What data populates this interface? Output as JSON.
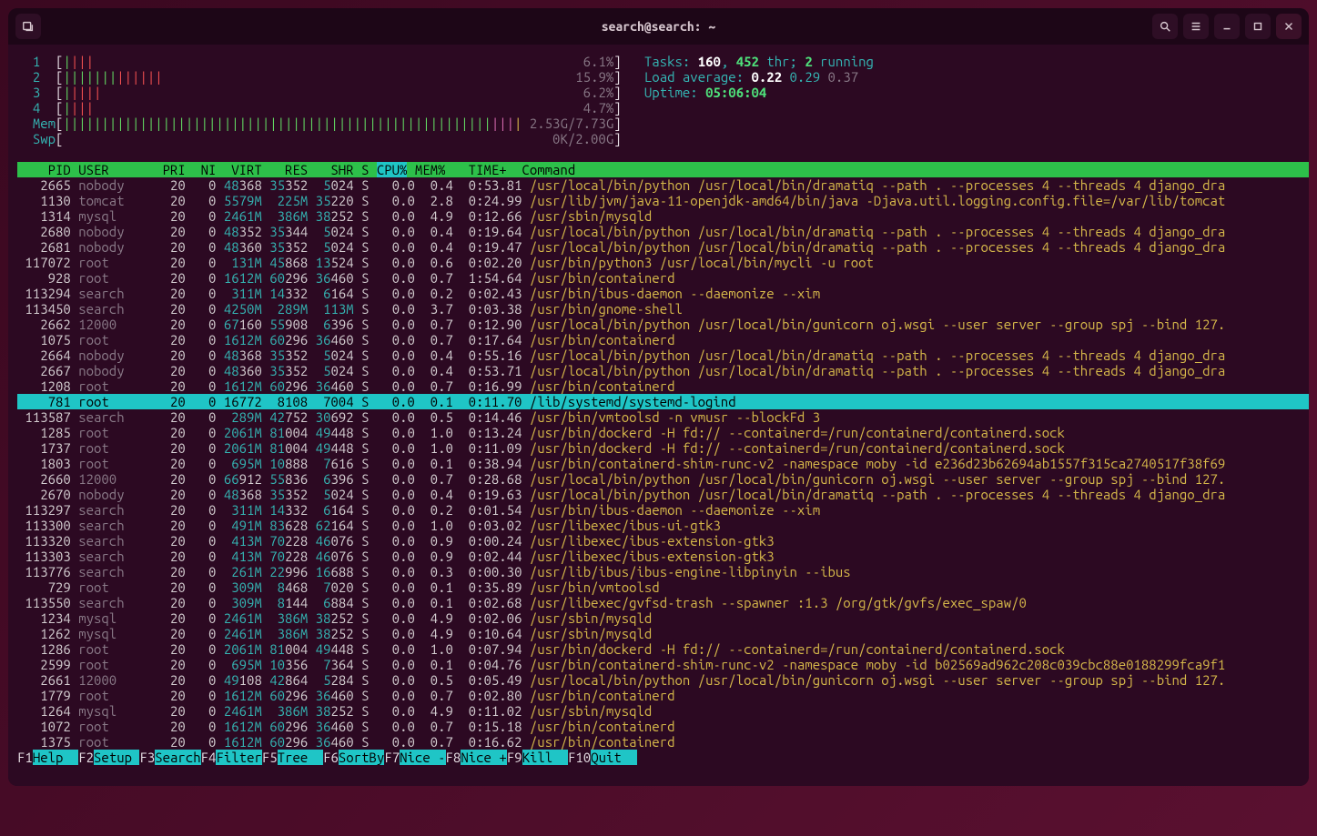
{
  "window": {
    "title": "search@search: ~"
  },
  "cpu_meters": [
    {
      "id": "1",
      "bars_g": 1,
      "bars_r": 3,
      "pct": "6.1%"
    },
    {
      "id": "2",
      "bars_g": 7,
      "bars_r": 6,
      "pct": "15.9%"
    },
    {
      "id": "3",
      "bars_g": 1,
      "bars_r": 4,
      "pct": "6.2%"
    },
    {
      "id": "4",
      "bars_g": 1,
      "bars_r": 3,
      "pct": "4.7%"
    }
  ],
  "mem": {
    "label": "Mem",
    "bars_g": 56,
    "bars_b": 3,
    "bars_y": 1,
    "text": "2.53G/7.73G"
  },
  "swp": {
    "label": "Swp",
    "text": "0K/2.00G"
  },
  "stats": {
    "tasks_label": "Tasks: ",
    "tasks": "160",
    "thr": "452",
    "thr_label": " thr; ",
    "running": "2",
    "running_label": " running",
    "loadavg_label": "Load average: ",
    "l1": "0.22",
    "l2": "0.29",
    "l3": "0.37",
    "uptime_label": "Uptime: ",
    "uptime": "05:06:04"
  },
  "columns": {
    "line": "    PID USER       PRI  NI  VIRT   RES   SHR S ",
    "sort": "CPU%",
    "rest": " MEM%   TIME+  Command"
  },
  "selected": {
    "pid": "781",
    "user": "root",
    "pri": "20",
    "ni": "0",
    "virt": "16772",
    "res": "8108",
    "shr": "7004",
    "s": "S",
    "cpu": "0.0",
    "mem": "0.1",
    "time": "0:11.70",
    "cmd": "/lib/systemd/systemd-logind"
  },
  "procs_pre": [
    {
      "pid": "2665",
      "user": "nobody",
      "pri": "20",
      "ni": "0",
      "virt": "48368",
      "vhi": "48",
      "res": "35352",
      "rhi": "35",
      "shr": "5024",
      "shi": "5",
      "s": "S",
      "cpu": "0.0",
      "mem": "0.4",
      "time": "0:53.81",
      "cmd": "/usr/local/bin/python /usr/local/bin/dramatiq --path . --processes 4 --threads 4 django_dra"
    },
    {
      "pid": "1130",
      "user": "tomcat",
      "pri": "20",
      "ni": "0",
      "virt": "5579M",
      "vhi": "5579M",
      "res": "225M",
      "rhi": "225M",
      "shr": "35220",
      "shi": "35",
      "s": "S",
      "cpu": "0.0",
      "mem": "2.8",
      "time": "0:24.99",
      "cmd": "/usr/lib/jvm/java-11-openjdk-amd64/bin/java -Djava.util.logging.config.file=/var/lib/tomcat"
    },
    {
      "pid": "1314",
      "user": "mysql",
      "pri": "20",
      "ni": "0",
      "virt": "2461M",
      "vhi": "2461M",
      "res": "386M",
      "rhi": "386M",
      "shr": "38252",
      "shi": "38",
      "s": "S",
      "cpu": "0.0",
      "mem": "4.9",
      "time": "0:12.66",
      "cmd": "/usr/sbin/mysqld"
    },
    {
      "pid": "2680",
      "user": "nobody",
      "pri": "20",
      "ni": "0",
      "virt": "48352",
      "vhi": "48",
      "res": "35344",
      "rhi": "35",
      "shr": "5024",
      "shi": "5",
      "s": "S",
      "cpu": "0.0",
      "mem": "0.4",
      "time": "0:19.64",
      "cmd": "/usr/local/bin/python /usr/local/bin/dramatiq --path . --processes 4 --threads 4 django_dra"
    },
    {
      "pid": "2681",
      "user": "nobody",
      "pri": "20",
      "ni": "0",
      "virt": "48360",
      "vhi": "48",
      "res": "35352",
      "rhi": "35",
      "shr": "5024",
      "shi": "5",
      "s": "S",
      "cpu": "0.0",
      "mem": "0.4",
      "time": "0:19.47",
      "cmd": "/usr/local/bin/python /usr/local/bin/dramatiq --path . --processes 4 --threads 4 django_dra"
    },
    {
      "pid": "117072",
      "user": "root",
      "pri": "20",
      "ni": "0",
      "virt": "131M",
      "vhi": "131M",
      "res": "45868",
      "rhi": "45",
      "shr": "13524",
      "shi": "13",
      "s": "S",
      "cpu": "0.0",
      "mem": "0.6",
      "time": "0:02.20",
      "cmd": "/usr/bin/python3 /usr/local/bin/mycli -u root"
    },
    {
      "pid": "928",
      "user": "root",
      "pri": "20",
      "ni": "0",
      "virt": "1612M",
      "vhi": "1612M",
      "res": "60296",
      "rhi": "60",
      "shr": "36460",
      "shi": "36",
      "s": "S",
      "cpu": "0.0",
      "mem": "0.7",
      "time": "1:54.64",
      "cmd": "/usr/bin/containerd"
    },
    {
      "pid": "113294",
      "user": "search",
      "pri": "20",
      "ni": "0",
      "virt": "311M",
      "vhi": "311M",
      "res": "14332",
      "rhi": "14",
      "shr": "6164",
      "shi": "6",
      "s": "S",
      "cpu": "0.0",
      "mem": "0.2",
      "time": "0:02.43",
      "cmd": "/usr/bin/ibus-daemon --daemonize --xim"
    },
    {
      "pid": "113450",
      "user": "search",
      "pri": "20",
      "ni": "0",
      "virt": "4250M",
      "vhi": "4250M",
      "res": "289M",
      "rhi": "289M",
      "shr": "113M",
      "shi": "113M",
      "s": "S",
      "cpu": "0.0",
      "mem": "3.7",
      "time": "0:03.38",
      "cmd": "/usr/bin/gnome-shell"
    },
    {
      "pid": "2662",
      "user": "12000",
      "pri": "20",
      "ni": "0",
      "virt": "67160",
      "vhi": "67",
      "res": "55908",
      "rhi": "55",
      "shr": "6396",
      "shi": "6",
      "s": "S",
      "cpu": "0.0",
      "mem": "0.7",
      "time": "0:12.90",
      "cmd": "/usr/local/bin/python /usr/local/bin/gunicorn oj.wsgi --user server --group spj --bind 127."
    },
    {
      "pid": "1075",
      "user": "root",
      "pri": "20",
      "ni": "0",
      "virt": "1612M",
      "vhi": "1612M",
      "res": "60296",
      "rhi": "60",
      "shr": "36460",
      "shi": "36",
      "s": "S",
      "cpu": "0.0",
      "mem": "0.7",
      "time": "0:17.64",
      "cmd": "/usr/bin/containerd"
    },
    {
      "pid": "2664",
      "user": "nobody",
      "pri": "20",
      "ni": "0",
      "virt": "48368",
      "vhi": "48",
      "res": "35352",
      "rhi": "35",
      "shr": "5024",
      "shi": "5",
      "s": "S",
      "cpu": "0.0",
      "mem": "0.4",
      "time": "0:55.16",
      "cmd": "/usr/local/bin/python /usr/local/bin/dramatiq --path . --processes 4 --threads 4 django_dra"
    },
    {
      "pid": "2667",
      "user": "nobody",
      "pri": "20",
      "ni": "0",
      "virt": "48360",
      "vhi": "48",
      "res": "35352",
      "rhi": "35",
      "shr": "5024",
      "shi": "5",
      "s": "S",
      "cpu": "0.0",
      "mem": "0.4",
      "time": "0:53.71",
      "cmd": "/usr/local/bin/python /usr/local/bin/dramatiq --path . --processes 4 --threads 4 django_dra"
    },
    {
      "pid": "1208",
      "user": "root",
      "pri": "20",
      "ni": "0",
      "virt": "1612M",
      "vhi": "1612M",
      "res": "60296",
      "rhi": "60",
      "shr": "36460",
      "shi": "36",
      "s": "S",
      "cpu": "0.0",
      "mem": "0.7",
      "time": "0:16.99",
      "cmd": "/usr/bin/containerd"
    }
  ],
  "procs_post": [
    {
      "pid": "113587",
      "user": "search",
      "pri": "20",
      "ni": "0",
      "virt": "289M",
      "vhi": "289M",
      "res": "42752",
      "rhi": "42",
      "shr": "30692",
      "shi": "30",
      "s": "S",
      "cpu": "0.0",
      "mem": "0.5",
      "time": "0:14.46",
      "cmd": "/usr/bin/vmtoolsd -n vmusr --blockFd 3"
    },
    {
      "pid": "1285",
      "user": "root",
      "pri": "20",
      "ni": "0",
      "virt": "2061M",
      "vhi": "2061M",
      "res": "81004",
      "rhi": "81",
      "shr": "49448",
      "shi": "49",
      "s": "S",
      "cpu": "0.0",
      "mem": "1.0",
      "time": "0:13.24",
      "cmd": "/usr/bin/dockerd -H fd:// --containerd=/run/containerd/containerd.sock"
    },
    {
      "pid": "1737",
      "user": "root",
      "pri": "20",
      "ni": "0",
      "virt": "2061M",
      "vhi": "2061M",
      "res": "81004",
      "rhi": "81",
      "shr": "49448",
      "shi": "49",
      "s": "S",
      "cpu": "0.0",
      "mem": "1.0",
      "time": "0:11.09",
      "cmd": "/usr/bin/dockerd -H fd:// --containerd=/run/containerd/containerd.sock"
    },
    {
      "pid": "1803",
      "user": "root",
      "pri": "20",
      "ni": "0",
      "virt": "695M",
      "vhi": "695M",
      "res": "10888",
      "rhi": "10",
      "shr": "7616",
      "shi": "7",
      "s": "S",
      "cpu": "0.0",
      "mem": "0.1",
      "time": "0:38.94",
      "cmd": "/usr/bin/containerd-shim-runc-v2 -namespace moby -id e236d23b62694ab1557f315ca2740517f38f69"
    },
    {
      "pid": "2660",
      "user": "12000",
      "pri": "20",
      "ni": "0",
      "virt": "66912",
      "vhi": "66",
      "res": "55836",
      "rhi": "55",
      "shr": "6396",
      "shi": "6",
      "s": "S",
      "cpu": "0.0",
      "mem": "0.7",
      "time": "0:28.68",
      "cmd": "/usr/local/bin/python /usr/local/bin/gunicorn oj.wsgi --user server --group spj --bind 127."
    },
    {
      "pid": "2670",
      "user": "nobody",
      "pri": "20",
      "ni": "0",
      "virt": "48368",
      "vhi": "48",
      "res": "35352",
      "rhi": "35",
      "shr": "5024",
      "shi": "5",
      "s": "S",
      "cpu": "0.0",
      "mem": "0.4",
      "time": "0:19.63",
      "cmd": "/usr/local/bin/python /usr/local/bin/dramatiq --path . --processes 4 --threads 4 django_dra"
    },
    {
      "pid": "113297",
      "user": "search",
      "pri": "20",
      "ni": "0",
      "virt": "311M",
      "vhi": "311M",
      "res": "14332",
      "rhi": "14",
      "shr": "6164",
      "shi": "6",
      "s": "S",
      "cpu": "0.0",
      "mem": "0.2",
      "time": "0:01.54",
      "cmd": "/usr/bin/ibus-daemon --daemonize --xim"
    },
    {
      "pid": "113300",
      "user": "search",
      "pri": "20",
      "ni": "0",
      "virt": "491M",
      "vhi": "491M",
      "res": "83628",
      "rhi": "83",
      "shr": "62164",
      "shi": "62",
      "s": "S",
      "cpu": "0.0",
      "mem": "1.0",
      "time": "0:03.02",
      "cmd": "/usr/libexec/ibus-ui-gtk3"
    },
    {
      "pid": "113320",
      "user": "search",
      "pri": "20",
      "ni": "0",
      "virt": "413M",
      "vhi": "413M",
      "res": "70228",
      "rhi": "70",
      "shr": "46076",
      "shi": "46",
      "s": "S",
      "cpu": "0.0",
      "mem": "0.9",
      "time": "0:00.24",
      "cmd": "/usr/libexec/ibus-extension-gtk3"
    },
    {
      "pid": "113303",
      "user": "search",
      "pri": "20",
      "ni": "0",
      "virt": "413M",
      "vhi": "413M",
      "res": "70228",
      "rhi": "70",
      "shr": "46076",
      "shi": "46",
      "s": "S",
      "cpu": "0.0",
      "mem": "0.9",
      "time": "0:02.44",
      "cmd": "/usr/libexec/ibus-extension-gtk3"
    },
    {
      "pid": "113776",
      "user": "search",
      "pri": "20",
      "ni": "0",
      "virt": "261M",
      "vhi": "261M",
      "res": "22996",
      "rhi": "22",
      "shr": "16688",
      "shi": "16",
      "s": "S",
      "cpu": "0.0",
      "mem": "0.3",
      "time": "0:00.30",
      "cmd": "/usr/lib/ibus/ibus-engine-libpinyin --ibus"
    },
    {
      "pid": "729",
      "user": "root",
      "pri": "20",
      "ni": "0",
      "virt": "309M",
      "vhi": "309M",
      "res": "8468",
      "rhi": "8",
      "shr": "7020",
      "shi": "7",
      "s": "S",
      "cpu": "0.0",
      "mem": "0.1",
      "time": "0:35.89",
      "cmd": "/usr/bin/vmtoolsd"
    },
    {
      "pid": "113550",
      "user": "search",
      "pri": "20",
      "ni": "0",
      "virt": "309M",
      "vhi": "309M",
      "res": "8144",
      "rhi": "8",
      "shr": "6884",
      "shi": "6",
      "s": "S",
      "cpu": "0.0",
      "mem": "0.1",
      "time": "0:02.68",
      "cmd": "/usr/libexec/gvfsd-trash --spawner :1.3 /org/gtk/gvfs/exec_spaw/0"
    },
    {
      "pid": "1234",
      "user": "mysql",
      "pri": "20",
      "ni": "0",
      "virt": "2461M",
      "vhi": "2461M",
      "res": "386M",
      "rhi": "386M",
      "shr": "38252",
      "shi": "38",
      "s": "S",
      "cpu": "0.0",
      "mem": "4.9",
      "time": "0:02.06",
      "cmd": "/usr/sbin/mysqld"
    },
    {
      "pid": "1262",
      "user": "mysql",
      "pri": "20",
      "ni": "0",
      "virt": "2461M",
      "vhi": "2461M",
      "res": "386M",
      "rhi": "386M",
      "shr": "38252",
      "shi": "38",
      "s": "S",
      "cpu": "0.0",
      "mem": "4.9",
      "time": "0:10.64",
      "cmd": "/usr/sbin/mysqld"
    },
    {
      "pid": "1286",
      "user": "root",
      "pri": "20",
      "ni": "0",
      "virt": "2061M",
      "vhi": "2061M",
      "res": "81004",
      "rhi": "81",
      "shr": "49448",
      "shi": "49",
      "s": "S",
      "cpu": "0.0",
      "mem": "1.0",
      "time": "0:07.94",
      "cmd": "/usr/bin/dockerd -H fd:// --containerd=/run/containerd/containerd.sock"
    },
    {
      "pid": "2599",
      "user": "root",
      "pri": "20",
      "ni": "0",
      "virt": "695M",
      "vhi": "695M",
      "res": "10356",
      "rhi": "10",
      "shr": "7364",
      "shi": "7",
      "s": "S",
      "cpu": "0.0",
      "mem": "0.1",
      "time": "0:04.76",
      "cmd": "/usr/bin/containerd-shim-runc-v2 -namespace moby -id b02569ad962c208c039cbc88e0188299fca9f1"
    },
    {
      "pid": "2661",
      "user": "12000",
      "pri": "20",
      "ni": "0",
      "virt": "49108",
      "vhi": "49",
      "res": "42864",
      "rhi": "42",
      "shr": "5284",
      "shi": "5",
      "s": "S",
      "cpu": "0.0",
      "mem": "0.5",
      "time": "0:05.49",
      "cmd": "/usr/local/bin/python /usr/local/bin/gunicorn oj.wsgi --user server --group spj --bind 127."
    },
    {
      "pid": "1779",
      "user": "root",
      "pri": "20",
      "ni": "0",
      "virt": "1612M",
      "vhi": "1612M",
      "res": "60296",
      "rhi": "60",
      "shr": "36460",
      "shi": "36",
      "s": "S",
      "cpu": "0.0",
      "mem": "0.7",
      "time": "0:02.80",
      "cmd": "/usr/bin/containerd"
    },
    {
      "pid": "1264",
      "user": "mysql",
      "pri": "20",
      "ni": "0",
      "virt": "2461M",
      "vhi": "2461M",
      "res": "386M",
      "rhi": "386M",
      "shr": "38252",
      "shi": "38",
      "s": "S",
      "cpu": "0.0",
      "mem": "4.9",
      "time": "0:11.02",
      "cmd": "/usr/sbin/mysqld"
    },
    {
      "pid": "1072",
      "user": "root",
      "pri": "20",
      "ni": "0",
      "virt": "1612M",
      "vhi": "1612M",
      "res": "60296",
      "rhi": "60",
      "shr": "36460",
      "shi": "36",
      "s": "S",
      "cpu": "0.0",
      "mem": "0.7",
      "time": "0:15.18",
      "cmd": "/usr/bin/containerd"
    },
    {
      "pid": "1375",
      "user": "root",
      "pri": "20",
      "ni": "0",
      "virt": "1612M",
      "vhi": "1612M",
      "res": "60296",
      "rhi": "60",
      "shr": "36460",
      "shi": "36",
      "s": "S",
      "cpu": "0.0",
      "mem": "0.7",
      "time": "0:16.62",
      "cmd": "/usr/bin/containerd"
    }
  ],
  "fkeys": [
    {
      "f": "F1",
      "l": "Help  "
    },
    {
      "f": "F2",
      "l": "Setup "
    },
    {
      "f": "F3",
      "l": "Search"
    },
    {
      "f": "F4",
      "l": "Filter"
    },
    {
      "f": "F5",
      "l": "Tree  "
    },
    {
      "f": "F6",
      "l": "SortBy"
    },
    {
      "f": "F7",
      "l": "Nice -"
    },
    {
      "f": "F8",
      "l": "Nice +"
    },
    {
      "f": "F9",
      "l": "Kill  "
    },
    {
      "f": "F10",
      "l": "Quit  "
    }
  ]
}
